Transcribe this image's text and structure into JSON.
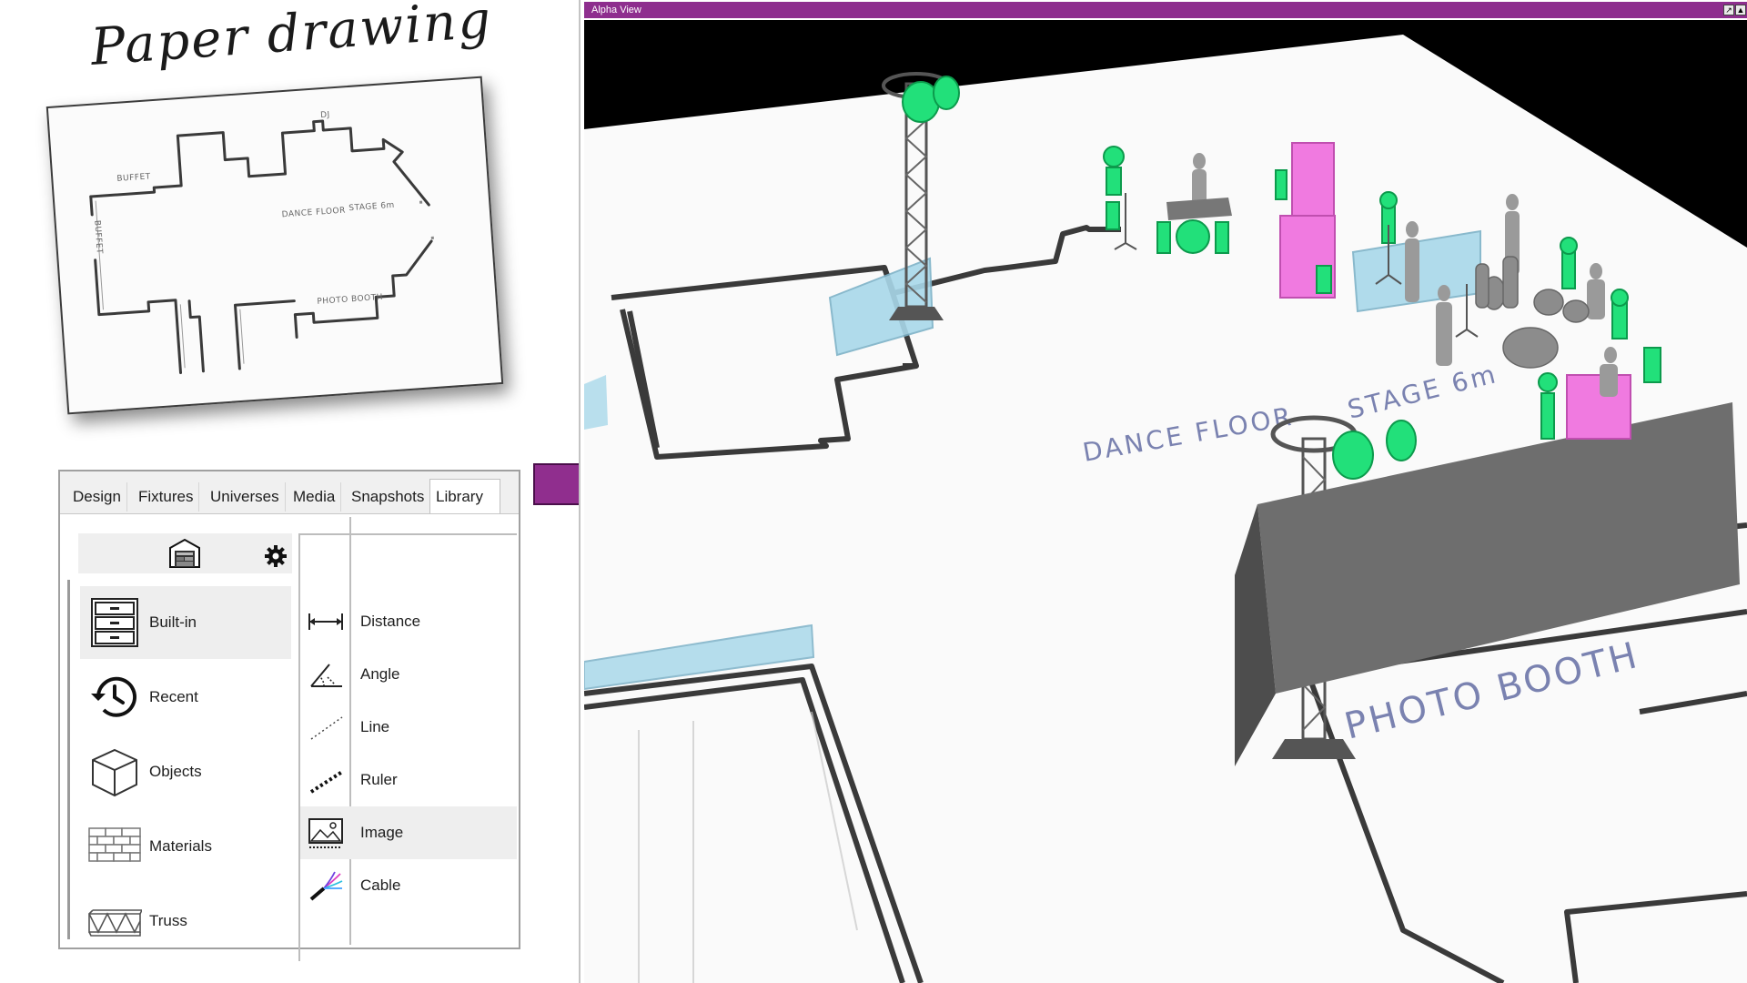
{
  "paper": {
    "title": "Paper drawing",
    "sketch_labels": {
      "buffet_top": "BUFFET",
      "buffet_side": "BUFFET",
      "dj": "DJ",
      "dance_floor": "DANCE FLOOR",
      "stage": "STAGE 6m",
      "photo_booth": "PHOTO BOOTH"
    }
  },
  "panel": {
    "tabs": [
      {
        "label": "Design"
      },
      {
        "label": "Fixtures"
      },
      {
        "label": "Universes"
      },
      {
        "label": "Media"
      },
      {
        "label": "Snapshots"
      },
      {
        "label": "Library",
        "active": true
      }
    ],
    "toolbar": {
      "warehouse_icon": "warehouse-icon",
      "settings_icon": "gear-icon"
    },
    "library_items": [
      {
        "label": "Built-in",
        "icon": "drawer-cabinet-icon",
        "selected": true
      },
      {
        "label": "Recent",
        "icon": "history-clock-icon"
      },
      {
        "label": "Objects",
        "icon": "cube-icon"
      },
      {
        "label": "Materials",
        "icon": "brick-wall-icon"
      },
      {
        "label": "Truss",
        "icon": "truss-icon"
      }
    ],
    "tools": [
      {
        "label": "Distance",
        "icon": "distance-icon"
      },
      {
        "label": "Angle",
        "icon": "angle-icon"
      },
      {
        "label": "Line",
        "icon": "dotted-line-icon"
      },
      {
        "label": "Ruler",
        "icon": "ruler-icon"
      },
      {
        "label": "Image",
        "icon": "image-icon",
        "selected": true
      },
      {
        "label": "Cable",
        "icon": "cable-icon"
      }
    ]
  },
  "viewport": {
    "title": "Alpha View",
    "floor_labels": {
      "dance_floor": "DANCE FLOOR",
      "stage": "STAGE 6m",
      "photo_booth": "PHOTO BOOTH"
    }
  },
  "colors": {
    "titlebar": "#8e2e8e",
    "arrow": "#902e8e",
    "fixture_green": "#22e07a",
    "speaker_pink": "#f07ae0",
    "backdrop_blue": "#a9d8ea",
    "screen_grey": "#6e6e6e"
  }
}
